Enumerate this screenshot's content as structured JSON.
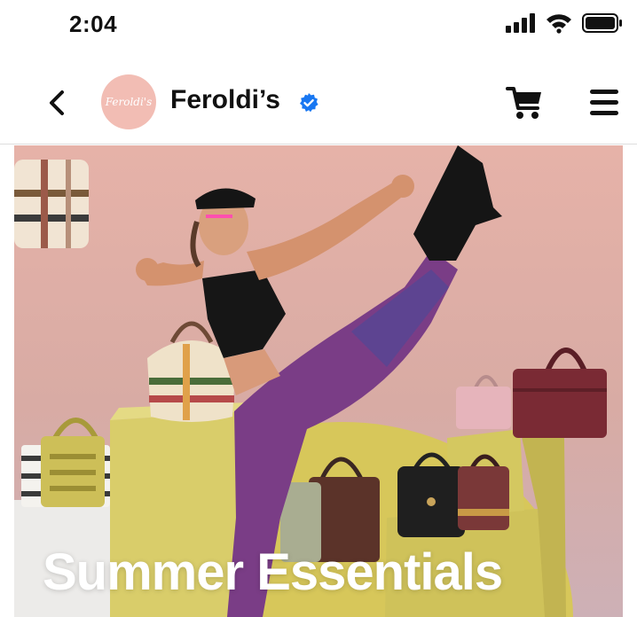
{
  "status_bar": {
    "time": "2:04",
    "icons": [
      "signal-icon",
      "wifi-icon",
      "battery-icon"
    ]
  },
  "nav": {
    "back_icon": "chevron-left-icon",
    "avatar_text": "Feroldi's",
    "store_name": "Feroldi’s",
    "verified_icon": "verified-badge-icon",
    "cart_icon": "cart-icon",
    "menu_icon": "hamburger-menu-icon"
  },
  "hero": {
    "title": "Summer Essentials"
  },
  "colors": {
    "accent_verified": "#1877f2",
    "avatar_bg": "#f2bdb4",
    "hero_bg": "#e6b2a8",
    "text": "#111111"
  }
}
